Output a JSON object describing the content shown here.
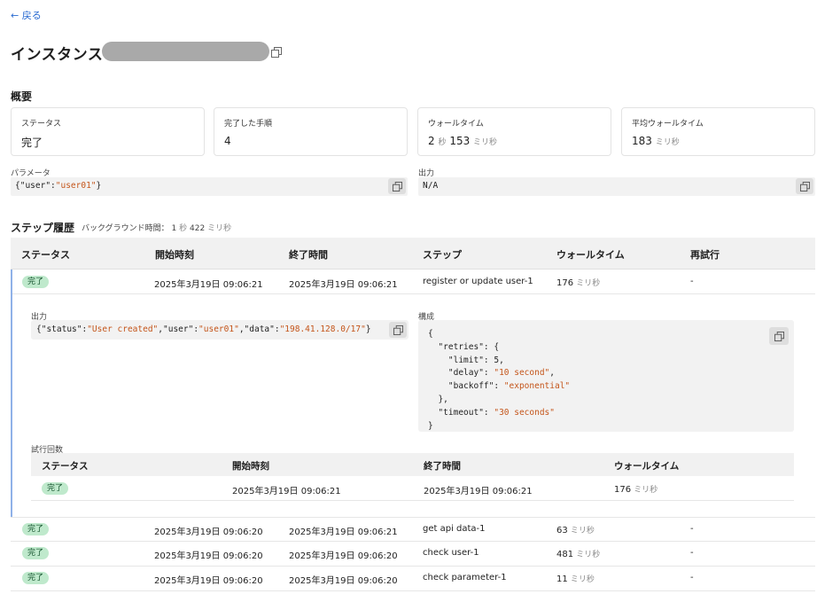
{
  "back_label": "← 戻る",
  "title": "インスタンス",
  "overview": {
    "heading": "概要",
    "cards": [
      {
        "label": "ステータス",
        "value": "完了",
        "unit": ""
      },
      {
        "label": "完了した手順",
        "value": "4",
        "unit": ""
      },
      {
        "label": "ウォールタイム",
        "value": "2",
        "unit": "秒",
        "value2": "153",
        "unit2": "ミリ秒"
      },
      {
        "label": "平均ウォールタイム",
        "value": "183",
        "unit": "ミリ秒"
      }
    ]
  },
  "params": {
    "label": "パラメータ",
    "value_prefix": "{\"user\":",
    "value_str": "\"user01\"",
    "value_suffix": "}"
  },
  "output": {
    "label": "出力",
    "value": "N/A"
  },
  "steps": {
    "heading": "ステップ履歴",
    "bg_label": "バックグラウンド時間：",
    "bg_value1": "1",
    "bg_unit1": "秒",
    "bg_value2": "422",
    "bg_unit2": "ミリ秒",
    "columns": [
      "ステータス",
      "開始時刻",
      "終了時間",
      "ステップ",
      "ウォールタイム",
      "再試行"
    ],
    "rows": [
      {
        "status": "完了",
        "start": "2025年3月19日 09:06:21",
        "end": "2025年3月19日 09:06:21",
        "step": "register or update user-1",
        "wall": "176",
        "unit": "ミリ秒",
        "retry": "-"
      },
      {
        "status": "完了",
        "start": "2025年3月19日 09:06:20",
        "end": "2025年3月19日 09:06:21",
        "step": "get api data-1",
        "wall": "63",
        "unit": "ミリ秒",
        "retry": "-"
      },
      {
        "status": "完了",
        "start": "2025年3月19日 09:06:20",
        "end": "2025年3月19日 09:06:20",
        "step": "check user-1",
        "wall": "481",
        "unit": "ミリ秒",
        "retry": "-"
      },
      {
        "status": "完了",
        "start": "2025年3月19日 09:06:20",
        "end": "2025年3月19日 09:06:20",
        "step": "check parameter-1",
        "wall": "11",
        "unit": "ミリ秒",
        "retry": "-"
      }
    ]
  },
  "detail": {
    "output_label": "出力",
    "output_parts": [
      "{\"status\":",
      "\"User created\"",
      ",\"user\":",
      "\"user01\"",
      ",\"data\":",
      "\"198.41.128.0/17\"",
      "}"
    ],
    "config_label": "構成",
    "config_lines": [
      {
        "k": "{",
        "s": ""
      },
      {
        "k": "  \"retries\": {",
        "s": ""
      },
      {
        "k": "    \"limit\": 5,",
        "s": ""
      },
      {
        "k": "    \"delay\": ",
        "s": "\"10 second\"",
        "t": ","
      },
      {
        "k": "    \"backoff\": ",
        "s": "\"exponential\"",
        "t": ""
      },
      {
        "k": "  },",
        "s": ""
      },
      {
        "k": "  \"timeout\": ",
        "s": "\"30 seconds\"",
        "t": ""
      },
      {
        "k": "}",
        "s": ""
      }
    ],
    "attempts_label": "試行回数",
    "attempt_columns": [
      "ステータス",
      "開始時刻",
      "終了時間",
      "ウォールタイム"
    ],
    "attempt": {
      "status": "完了",
      "start": "2025年3月19日 09:06:21",
      "end": "2025年3月19日 09:06:21",
      "wall": "176",
      "unit": "ミリ秒"
    }
  },
  "icons": {
    "copy": "copy-icon"
  },
  "colors": {
    "badge_bg": "#bfe9cc",
    "string": "#c4551a",
    "link": "#2a6bd1"
  }
}
